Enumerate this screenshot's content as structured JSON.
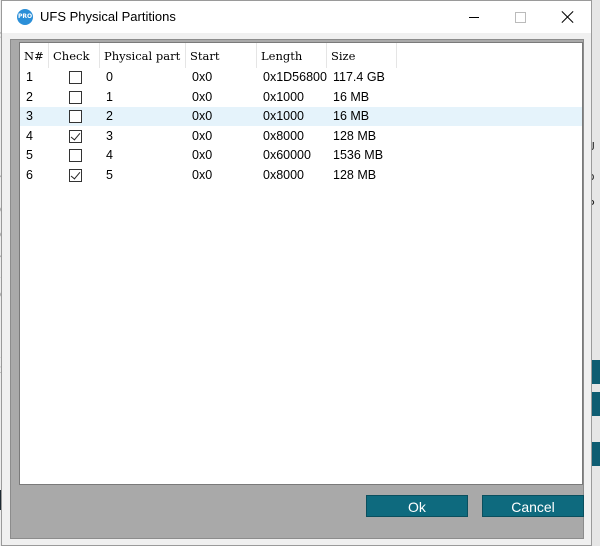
{
  "window": {
    "title": "UFS Physical Partitions",
    "icon_label": "PRO"
  },
  "list": {
    "columns": [
      "N#",
      "Check",
      "Physical part",
      "Start",
      "Length",
      "Size"
    ],
    "rows": [
      {
        "n": "1",
        "checked": false,
        "part": "0",
        "start": "0x0",
        "length": "0x1D56800",
        "size": "117.4 GB",
        "highlight": false
      },
      {
        "n": "2",
        "checked": false,
        "part": "1",
        "start": "0x0",
        "length": "0x1000",
        "size": "16 MB",
        "highlight": false
      },
      {
        "n": "3",
        "checked": false,
        "part": "2",
        "start": "0x0",
        "length": "0x1000",
        "size": "16 MB",
        "highlight": true
      },
      {
        "n": "4",
        "checked": true,
        "part": "3",
        "start": "0x0",
        "length": "0x8000",
        "size": "128 MB",
        "highlight": false
      },
      {
        "n": "5",
        "checked": false,
        "part": "4",
        "start": "0x0",
        "length": "0x60000",
        "size": "1536 MB",
        "highlight": false
      },
      {
        "n": "6",
        "checked": true,
        "part": "5",
        "start": "0x0",
        "length": "0x8000",
        "size": "128 MB",
        "highlight": false
      }
    ]
  },
  "buttons": {
    "ok": "Ok",
    "cancel": "Cancel"
  },
  "colors": {
    "button_bg": "#0e6a7e",
    "row_highlight": "#e5f3fb",
    "frame_gray": "#a9a9a9"
  }
}
